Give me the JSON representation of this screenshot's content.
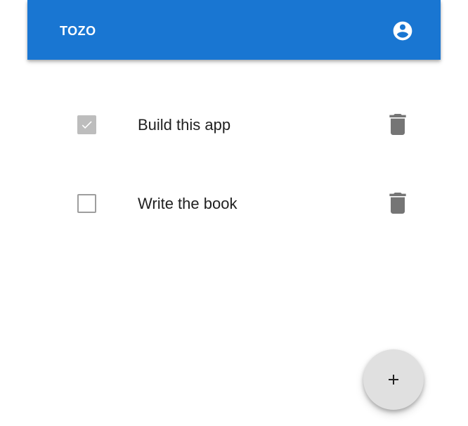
{
  "appbar": {
    "title": "TOZO",
    "color": "#1976d2",
    "account_icon": "account-circle-icon"
  },
  "todos": [
    {
      "label": "Build this app",
      "checked": true,
      "delete_icon": "trash-icon"
    },
    {
      "label": "Write the book",
      "checked": false,
      "delete_icon": "trash-icon"
    }
  ],
  "fab": {
    "icon": "plus-icon"
  }
}
